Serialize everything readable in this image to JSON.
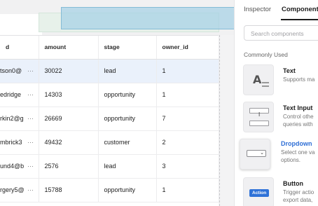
{
  "table": {
    "columns": [
      "d",
      "amount",
      "stage",
      "owner_id"
    ],
    "rows": [
      {
        "email": "tson0@",
        "amount": "30022",
        "stage": "lead",
        "owner_id": "1",
        "selected": true
      },
      {
        "email": "edridge",
        "amount": "14303",
        "stage": "opportunity",
        "owner_id": "1"
      },
      {
        "email": "rkin2@g",
        "amount": "26669",
        "stage": "opportunity",
        "owner_id": "7"
      },
      {
        "email": "mbrick3",
        "amount": "49432",
        "stage": "customer",
        "owner_id": "2"
      },
      {
        "email": "und4@b",
        "amount": "2576",
        "stage": "lead",
        "owner_id": "3"
      },
      {
        "email": "rgery5@",
        "amount": "15788",
        "stage": "opportunity",
        "owner_id": "1"
      }
    ],
    "more_glyph": "···"
  },
  "panel": {
    "tabs": [
      {
        "label": "Inspector",
        "active": false
      },
      {
        "label": "Components",
        "active": true
      }
    ],
    "search_placeholder": "Search components",
    "section_label": "Commonly Used",
    "components": [
      {
        "name": "Text",
        "desc_lines": [
          "Supports ma"
        ],
        "icon": "text-icon"
      },
      {
        "name": "Text Input",
        "desc_lines": [
          "Control othe",
          "queries with"
        ],
        "icon": "text-input-icon"
      },
      {
        "name": "Dropdown",
        "desc_lines": [
          "Select one va",
          "options."
        ],
        "icon": "dropdown-icon",
        "dragging": true
      },
      {
        "name": "Button",
        "desc_lines": [
          "Trigger actio",
          "export data,"
        ],
        "icon": "button-icon",
        "icon_label": "Action"
      }
    ]
  },
  "colors": {
    "accent": "#2f72d8",
    "selected_row": "#eaf1fb",
    "drag_ghost": "#a4d0e6",
    "drop_zone": "#e7f1ea"
  }
}
